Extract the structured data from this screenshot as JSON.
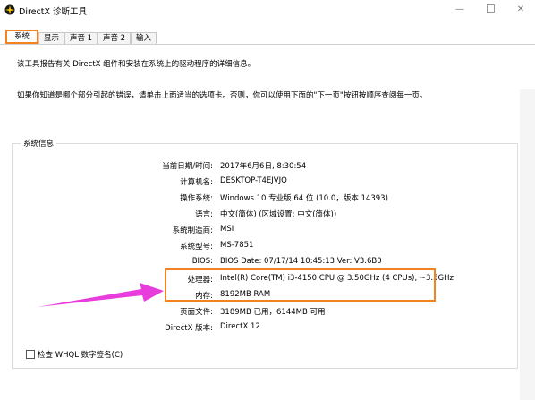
{
  "window": {
    "title": "DirectX 诊断工具",
    "min_glyph": "—",
    "close_glyph": "✕"
  },
  "tabs": [
    {
      "label": "系统",
      "active": true
    },
    {
      "label": "显示",
      "active": false
    },
    {
      "label": "声音 1",
      "active": false
    },
    {
      "label": "声音 2",
      "active": false
    },
    {
      "label": "输入",
      "active": false
    }
  ],
  "intro": {
    "line1": "该工具报告有关 DirectX 组件和安装在系统上的驱动程序的详细信息。",
    "line2": "如果你知道是哪个部分引起的错误，请单击上面适当的选项卡。否则，你可以使用下面的\"下一页\"按钮按顺序查阅每一页。"
  },
  "system_info": {
    "group_title": "系统信息",
    "rows": [
      {
        "label": "当前日期/时间:",
        "value": "2017年6月6日, 8:30:54"
      },
      {
        "label": "计算机名:",
        "value": "DESKTOP-T4EJVJQ"
      },
      {
        "label": "操作系统:",
        "value": "Windows 10 专业版 64 位 (10.0，版本 14393)"
      },
      {
        "label": "语言:",
        "value": "中文(简体) (区域设置: 中文(简体))"
      },
      {
        "label": "系统制造商:",
        "value": "MSI"
      },
      {
        "label": "系统型号:",
        "value": "MS-7851"
      },
      {
        "label": "BIOS:",
        "value": "BIOS Date: 07/17/14 10:45:13 Ver: V3.6B0"
      },
      {
        "label": "处理器:",
        "value": "Intel(R) Core(TM) i3-4150 CPU @ 3.50GHz (4 CPUs), ~3.5GHz"
      },
      {
        "label": "内存:",
        "value": "8192MB RAM"
      },
      {
        "label": "页面文件:",
        "value": "3189MB 已用，6144MB 可用"
      },
      {
        "label": "DirectX 版本:",
        "value": "DirectX 12"
      }
    ]
  },
  "checkbox": {
    "label": "检查 WHQL 数字签名(C)",
    "checked": false
  },
  "colors": {
    "highlight": "#f58220",
    "arrow": "#e83ddc"
  },
  "icons": {
    "app": "directx-icon",
    "arrow": "pointer-arrow"
  }
}
